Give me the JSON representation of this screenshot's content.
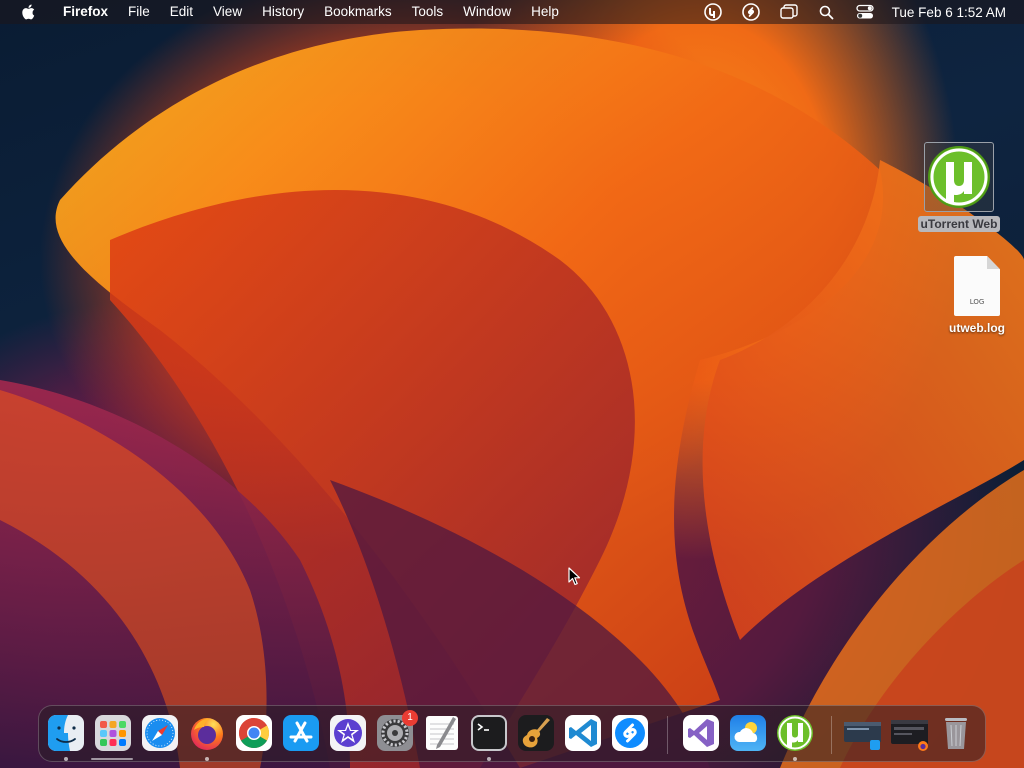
{
  "menubar": {
    "app_name": "Firefox",
    "menus": [
      "File",
      "Edit",
      "View",
      "History",
      "Bookmarks",
      "Tools",
      "Window",
      "Help"
    ],
    "status_icons": [
      "utorrent-web-status-icon",
      "shazam-status-icon",
      "window-status-icon",
      "spotlight-search-icon",
      "control-center-icon"
    ],
    "clock": "Tue Feb 6  1:52 AM"
  },
  "desktop": {
    "items": [
      {
        "label": "uTorrent Web",
        "icon": "utorrent-icon",
        "selected": true
      },
      {
        "label": "utweb.log",
        "icon": "log-file-icon",
        "doc_text": "LOG",
        "selected": false
      }
    ]
  },
  "dock": {
    "apps": [
      {
        "name": "Finder",
        "icon": "finder-icon",
        "running": true
      },
      {
        "name": "Launchpad",
        "icon": "launchpad-icon",
        "running": false
      },
      {
        "name": "Safari",
        "icon": "safari-icon",
        "running": false
      },
      {
        "name": "Firefox",
        "icon": "firefox-icon",
        "running": true
      },
      {
        "name": "Google Chrome",
        "icon": "chrome-icon",
        "running": false
      },
      {
        "name": "App Store",
        "icon": "app-store-icon",
        "running": false
      },
      {
        "name": "iMovie",
        "icon": "imovie-icon",
        "running": false
      },
      {
        "name": "System Settings",
        "icon": "system-settings-icon",
        "running": false,
        "badge": "1"
      },
      {
        "name": "TextEdit",
        "icon": "textedit-icon",
        "running": false
      },
      {
        "name": "Terminal",
        "icon": "terminal-icon",
        "running": true
      },
      {
        "name": "GarageBand",
        "icon": "garageband-icon",
        "running": false
      },
      {
        "name": "Visual Studio Code",
        "icon": "vscode-icon",
        "running": false
      },
      {
        "name": "Shazam",
        "icon": "shazam-icon",
        "running": false
      },
      {
        "name": "Visual Studio",
        "icon": "visual-studio-icon",
        "running": false
      },
      {
        "name": "Weather",
        "icon": "weather-icon",
        "running": false
      },
      {
        "name": "uTorrent Web",
        "icon": "utorrent-icon",
        "running": true
      }
    ],
    "minimized": [
      {
        "name": "Finder window",
        "icon": "minimized-finder-window-icon"
      },
      {
        "name": "Firefox window",
        "icon": "minimized-firefox-window-icon"
      }
    ],
    "trash": {
      "name": "Trash",
      "icon": "trash-icon"
    }
  },
  "colors": {
    "utorrent_green": "#6cbf2a",
    "badge_red": "#ea3c33",
    "vscode_blue": "#1f8ad2",
    "wallpaper_orange": "#f06a16"
  }
}
